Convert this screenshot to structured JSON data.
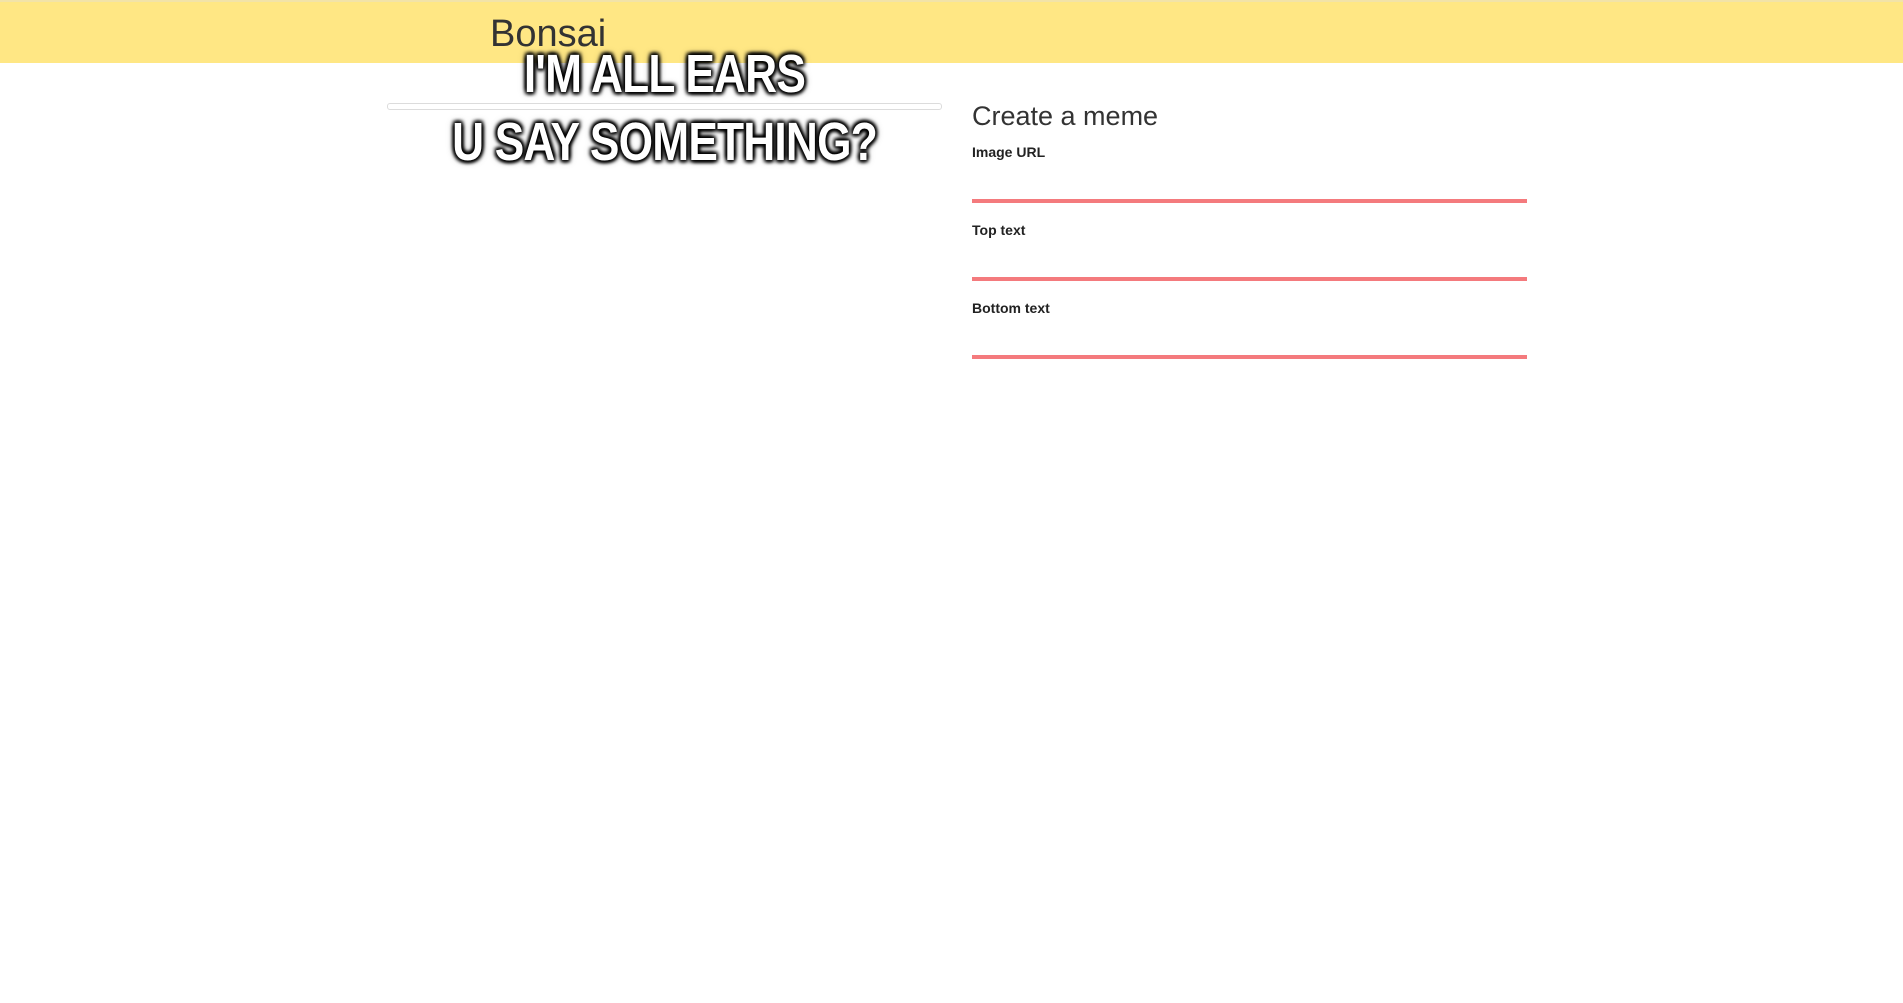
{
  "header": {
    "brand": "Bonsai"
  },
  "meme": {
    "top_text": "I'M ALL EARS",
    "bottom_text": "U SAY SOMETHING?"
  },
  "form": {
    "title": "Create a meme",
    "fields": [
      {
        "label": "Image URL",
        "value": "",
        "placeholder": ""
      },
      {
        "label": "Top text",
        "value": "",
        "placeholder": ""
      },
      {
        "label": "Bottom text",
        "value": "",
        "placeholder": ""
      }
    ]
  },
  "colors": {
    "header_background": "#ffe784",
    "input_underline": "#f47a7d",
    "meme_text": "#ffffff"
  }
}
